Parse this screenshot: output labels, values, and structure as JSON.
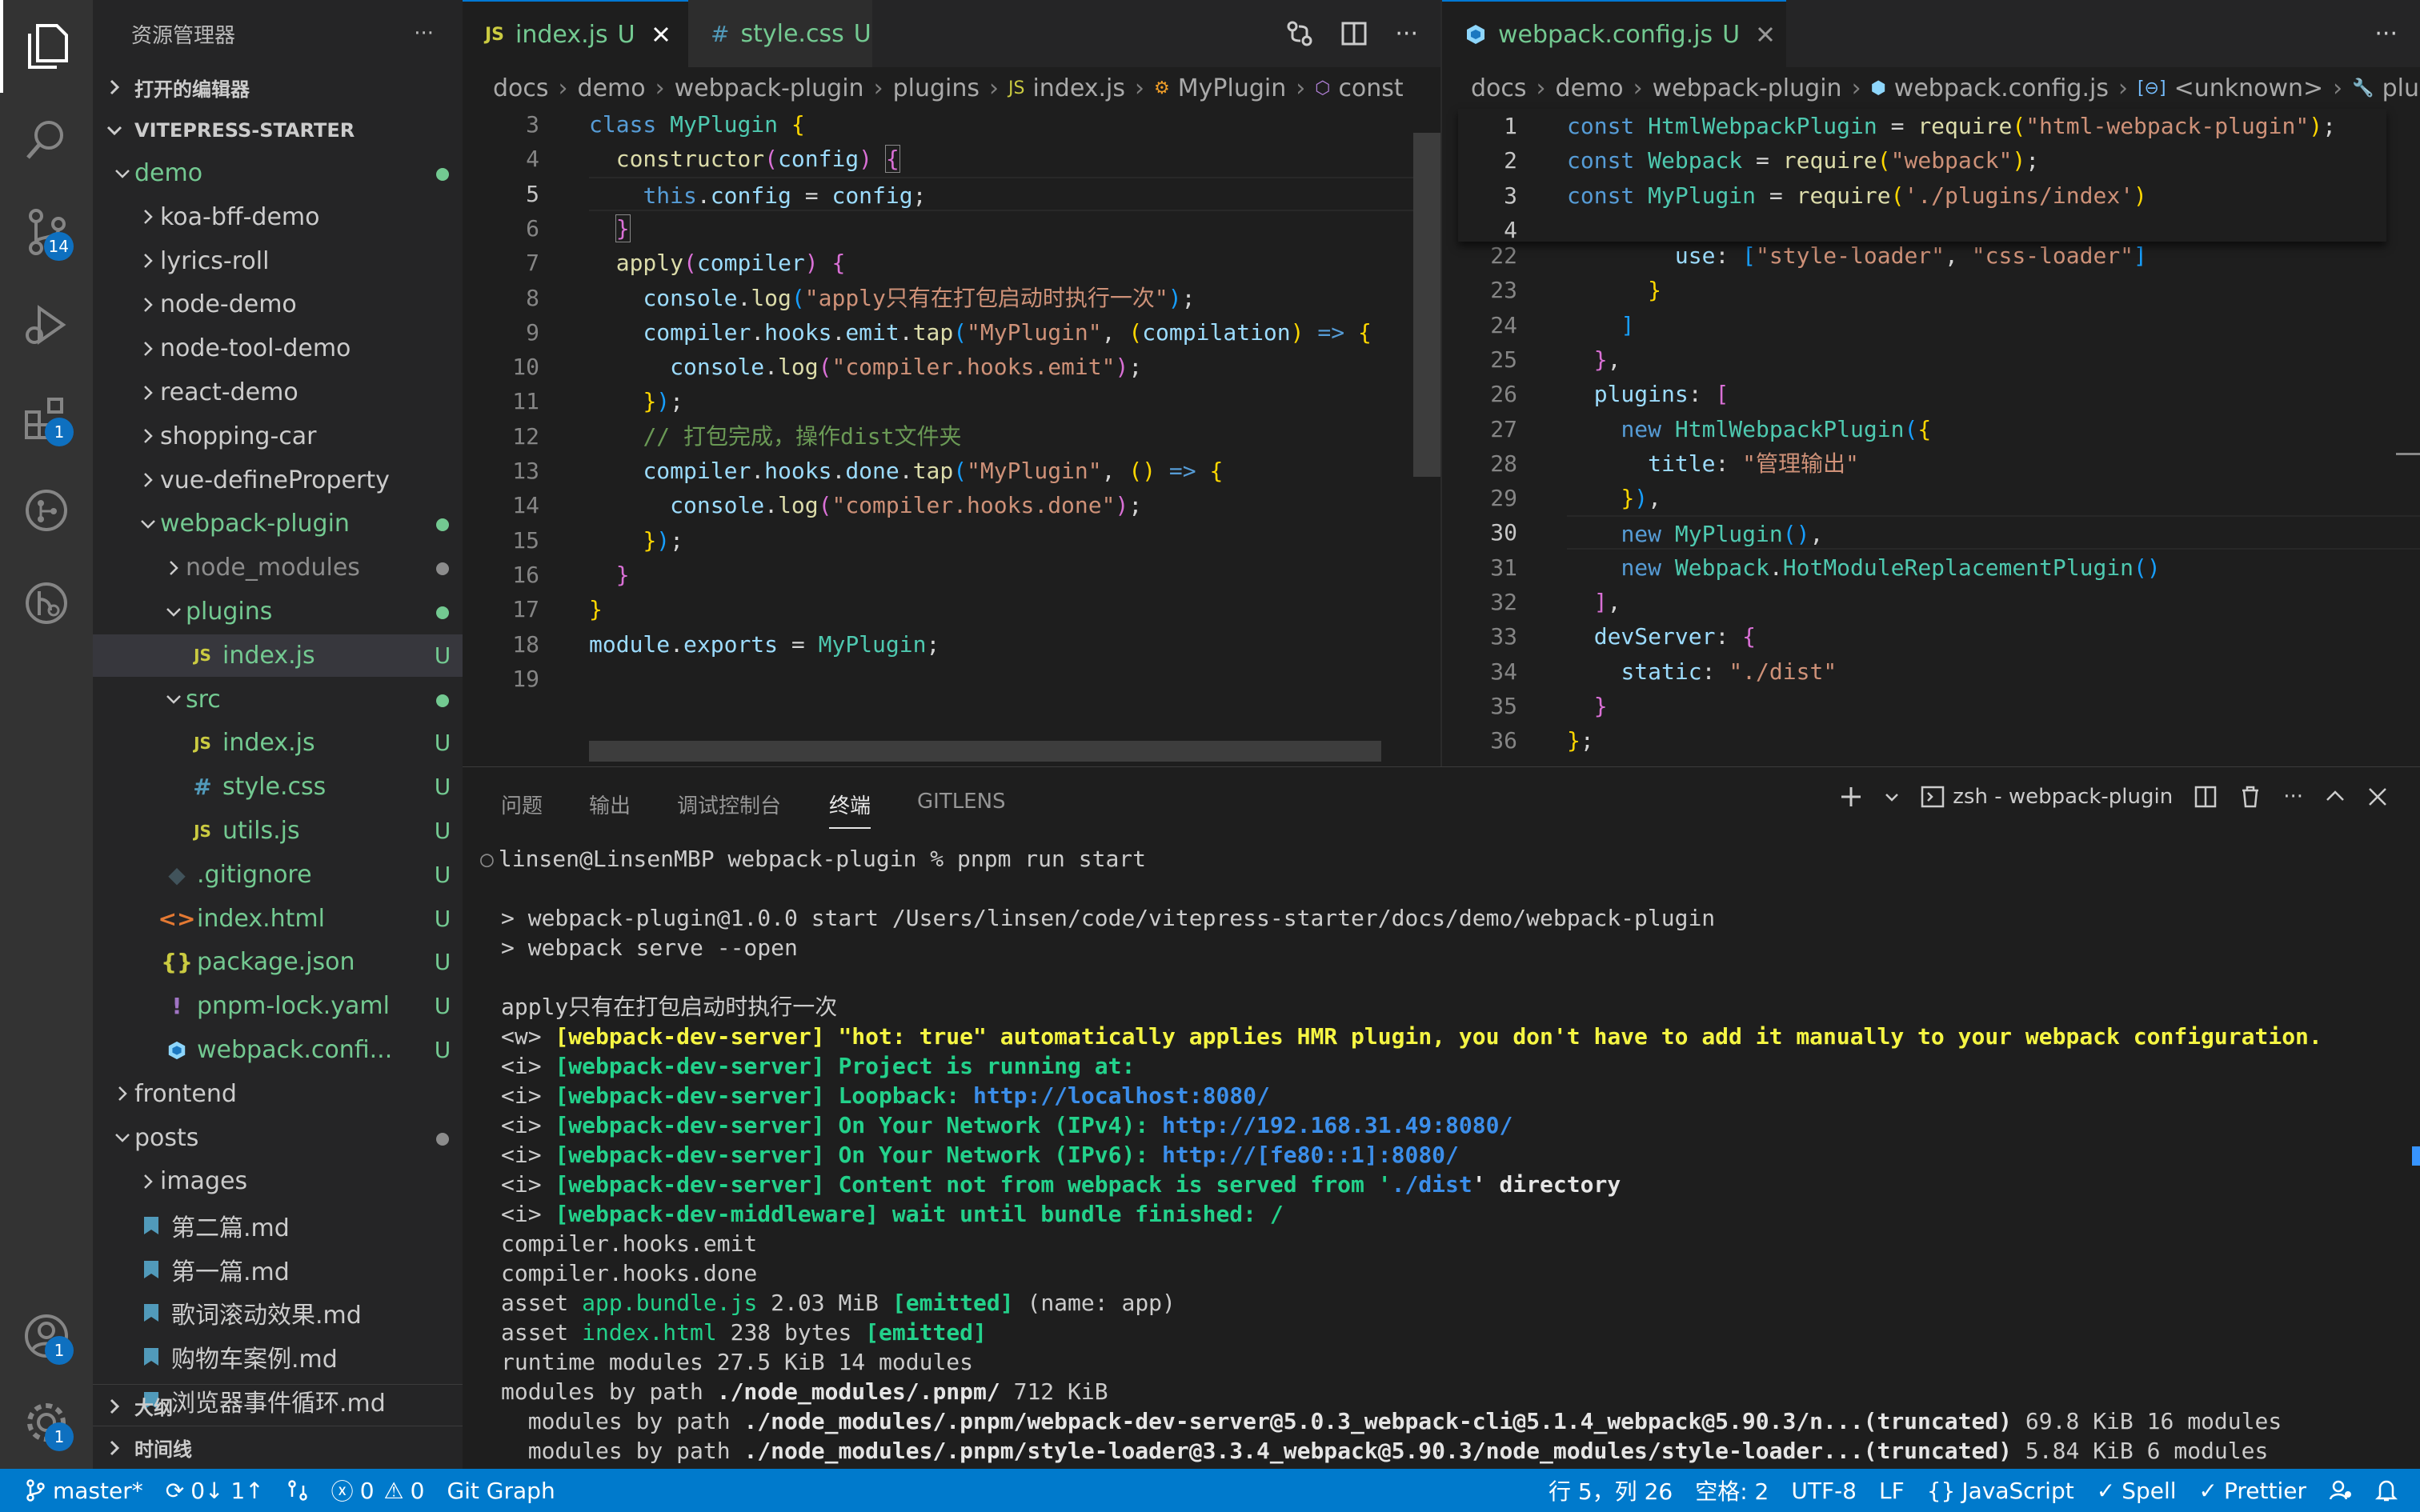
{
  "colors": {
    "accent": "#007acc",
    "git_untracked": "#73c991",
    "badge": "#0e70c0"
  },
  "activity": {
    "scm_badge": "14",
    "extensions_badge": "1",
    "accounts_badge": "1",
    "settings_badge": "1"
  },
  "sidebar": {
    "title": "资源管理器",
    "more": "···",
    "open_editors": "打开的编辑器",
    "project": "VITEPRESS-STARTER",
    "outline": "大纲",
    "timeline": "时间线",
    "tree": [
      {
        "label": "demo",
        "status": "",
        "icon": "folder-open"
      },
      {
        "label": "koa-bff-demo",
        "status": "",
        "icon": "folder"
      },
      {
        "label": "lyrics-roll",
        "status": "",
        "icon": "folder"
      },
      {
        "label": "node-demo",
        "status": "",
        "icon": "folder"
      },
      {
        "label": "node-tool-demo",
        "status": "",
        "icon": "folder"
      },
      {
        "label": "react-demo",
        "status": "",
        "icon": "folder"
      },
      {
        "label": "shopping-car",
        "status": "",
        "icon": "folder"
      },
      {
        "label": "vue-defineProperty",
        "status": "",
        "icon": "folder"
      },
      {
        "label": "webpack-plugin",
        "status": "",
        "icon": "folder-open"
      },
      {
        "label": "node_modules",
        "status": "",
        "icon": "folder"
      },
      {
        "label": "plugins",
        "status": "",
        "icon": "folder-open"
      },
      {
        "label": "index.js",
        "status": "U",
        "icon": "JS"
      },
      {
        "label": "src",
        "status": "",
        "icon": "folder-open"
      },
      {
        "label": "index.js",
        "status": "U",
        "icon": "JS"
      },
      {
        "label": "style.css",
        "status": "U",
        "icon": "#"
      },
      {
        "label": "utils.js",
        "status": "U",
        "icon": "JS"
      },
      {
        "label": ".gitignore",
        "status": "U",
        "icon": "◆"
      },
      {
        "label": "index.html",
        "status": "U",
        "icon": "<>"
      },
      {
        "label": "package.json",
        "status": "U",
        "icon": "{}"
      },
      {
        "label": "pnpm-lock.yaml",
        "status": "U",
        "icon": "!"
      },
      {
        "label": "webpack.confi...",
        "status": "U",
        "icon": "cube"
      },
      {
        "label": "frontend",
        "status": "",
        "icon": "folder"
      },
      {
        "label": "posts",
        "status": "",
        "icon": "folder-open"
      },
      {
        "label": "images",
        "status": "",
        "icon": "folder"
      },
      {
        "label": "第二篇.md",
        "status": "",
        "icon": "md"
      },
      {
        "label": "第一篇.md",
        "status": "",
        "icon": "md"
      },
      {
        "label": "歌词滚动效果.md",
        "status": "",
        "icon": "md"
      },
      {
        "label": "购物车案例.md",
        "status": "",
        "icon": "md"
      },
      {
        "label": "浏览器事件循环.md",
        "status": "",
        "icon": "md"
      }
    ]
  },
  "left_editor": {
    "tabs": [
      {
        "label": "index.js",
        "status": "U",
        "icon": "JS"
      },
      {
        "label": "style.css",
        "status": "U",
        "icon": "#"
      }
    ],
    "breadcrumb": [
      "docs",
      "demo",
      "webpack-plugin",
      "plugins",
      "index.js",
      "MyPlugin",
      "const"
    ],
    "line_numbers": [
      "3",
      "4",
      "5",
      "6",
      "7",
      "8",
      "9",
      "10",
      "11",
      "12",
      "13",
      "14",
      "15",
      "16",
      "17",
      "18",
      "19"
    ]
  },
  "right_editor": {
    "tab": {
      "label": "webpack.config.js",
      "status": "U"
    },
    "breadcrumb": [
      "docs",
      "demo",
      "webpack-plugin",
      "webpack.config.js",
      "<unknown>",
      "plu"
    ],
    "sticky_line_numbers": [
      "1",
      "2",
      "3",
      "4"
    ],
    "line_numbers": [
      "22",
      "23",
      "24",
      "25",
      "26",
      "27",
      "28",
      "29",
      "30",
      "31",
      "32",
      "33",
      "34",
      "35",
      "36"
    ]
  },
  "panel": {
    "tabs": [
      "问题",
      "输出",
      "调试控制台",
      "终端",
      "GITLENS"
    ],
    "terminal_name": "zsh - webpack-plugin",
    "prompt": "linsen@LinsenMBP webpack-plugin % pnpm run start",
    "lines": [
      "",
      "> webpack-plugin@1.0.0 start /Users/linsen/code/vitepress-starter/docs/demo/webpack-plugin",
      "> webpack serve --open",
      "",
      "apply只有在打包启动时执行一次"
    ],
    "ws_warn_prefix": "<w> ",
    "ws_warn": "[webpack-dev-server] \"hot: true\" automatically applies HMR plugin, you don't have to add it manually to your webpack configuration.",
    "info": [
      {
        "tag": "[webpack-dev-server]",
        "text": " Project is running at:",
        "url": ""
      },
      {
        "tag": "[webpack-dev-server]",
        "text": " Loopback: ",
        "url": "http://localhost:8080/"
      },
      {
        "tag": "[webpack-dev-server]",
        "text": " On Your Network (IPv4): ",
        "url": "http://192.168.31.49:8080/"
      },
      {
        "tag": "[webpack-dev-server]",
        "text": " On Your Network (IPv6): ",
        "url": "http://[fe80::1]:8080/"
      },
      {
        "tag": "[webpack-dev-server]",
        "text": " Content not from webpack is served from '",
        "url": "./dist"
      },
      {
        "tag": "[webpack-dev-middleware]",
        "text": " wait until bundle finished: /",
        "url": ""
      }
    ],
    "content_suffix": "' directory",
    "info_prefix": "<i> ",
    "tail": [
      "compiler.hooks.emit",
      "compiler.hooks.done"
    ],
    "asset1": {
      "pre": "asset ",
      "name": "app.bundle.js",
      "size": " 2.03 MiB ",
      "flag": "[emitted]",
      "post": " (name: app)"
    },
    "asset2": {
      "pre": "asset ",
      "name": "index.html",
      "size": " 238 bytes ",
      "flag": "[emitted]",
      "post": ""
    },
    "runtime": "runtime modules 27.5 KiB 14 modules",
    "modules_path": {
      "pre": "modules by path ",
      "path": "./node_modules/.pnpm/",
      "post": " 712 KiB"
    },
    "mod1": {
      "pre": "  modules by path ",
      "path": "./node_modules/.pnpm/webpack-dev-server@5.0.3_webpack-cli@5.1.4_webpack@5.90.3/n...(truncated)",
      "post": " 69.8 KiB 16 modules"
    },
    "mod2": {
      "pre": "  modules by path ",
      "path": "./node_modules/.pnpm/style-loader@3.3.4_webpack@5.90.3/node_modules/style-loader...(truncated)",
      "post": " 5.84 KiB 6 modules"
    }
  },
  "status": {
    "branch": "master*",
    "sync": "0↓ 1↑",
    "errors": "0",
    "warnings": "0",
    "git_graph": "Git Graph",
    "position": "行 5，列 26",
    "indent": "空格: 2",
    "encoding": "UTF-8",
    "eol": "LF",
    "language": "JavaScript",
    "spell": "Spell",
    "prettier": "Prettier"
  }
}
